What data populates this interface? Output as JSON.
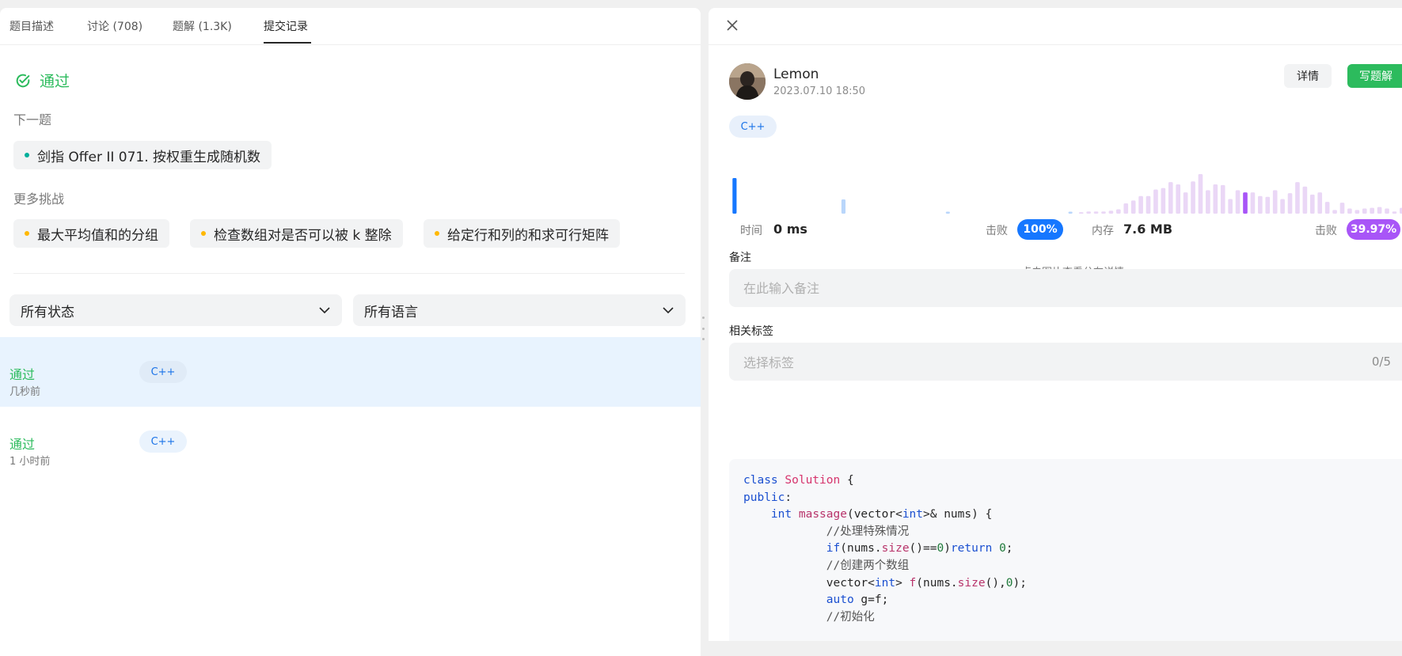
{
  "tabs": [
    {
      "label": "题目描述"
    },
    {
      "label": "讨论 (708)"
    },
    {
      "label": "题解 (1.3K)"
    },
    {
      "label": "提交记录"
    }
  ],
  "result": {
    "status": "通过"
  },
  "next": {
    "title": "下一题",
    "item": "剑指 Offer II 071. 按权重生成随机数"
  },
  "more": {
    "title": "更多挑战",
    "items": [
      "最大平均值和的分组",
      "检查数组对是否可以被 k 整除",
      "给定行和列的和求可行矩阵"
    ]
  },
  "filters": {
    "status": "所有状态",
    "language": "所有语言"
  },
  "submissions": [
    {
      "status": "通过",
      "time": "几秒前",
      "lang": "C++"
    },
    {
      "status": "通过",
      "time": "1 小时前",
      "lang": "C++"
    }
  ],
  "detail": {
    "user": "Lemon",
    "date": "2023.07.10 18:50",
    "detail_btn": "详情",
    "write_btn": "写题解",
    "lang": "C++",
    "runtime": {
      "label": "时间",
      "value": "0 ms",
      "beat_label": "击败",
      "beat": "100%"
    },
    "memory": {
      "label": "内存",
      "value": "7.6 MB",
      "beat_label": "击败",
      "beat": "39.97%"
    },
    "hint": "点击图片查看分布详情",
    "note_label": "备注",
    "note_placeholder": "在此输入备注",
    "tags_label": "相关标签",
    "tags_placeholder": "选择标签",
    "tags_count": "0/5"
  },
  "colors": {
    "accent": "#2cbb5d",
    "blue": "#1a73e8",
    "purple": "#a855f7",
    "memory_bar": "#ead7f6",
    "runtime_bar": "#1677ff"
  },
  "chart_data": [
    {
      "type": "bar",
      "title": "runtime distribution",
      "series": [
        {
          "name": "runtime",
          "values": [
            55,
            0,
            0,
            0,
            0,
            0,
            0,
            0,
            0,
            0,
            0,
            0,
            0,
            0,
            0,
            0,
            0,
            0,
            0,
            0,
            0,
            0,
            0,
            0,
            22,
            0,
            0,
            0,
            0,
            0,
            0,
            0,
            0,
            0,
            0,
            0,
            0,
            0,
            0,
            0,
            0,
            0,
            0,
            0,
            0,
            0,
            0,
            3,
            0,
            0,
            0,
            0,
            0,
            0,
            0,
            0,
            0,
            0,
            0,
            0,
            0,
            0,
            0,
            0,
            0,
            0,
            0,
            0,
            0,
            0,
            0,
            0,
            0,
            0,
            3
          ]
        }
      ],
      "highlight_index": 0
    },
    {
      "type": "bar",
      "title": "memory distribution",
      "series": [
        {
          "name": "memory",
          "values": [
            2,
            3,
            3,
            3,
            4,
            6,
            14,
            18,
            24,
            24,
            33,
            35,
            43,
            40,
            29,
            44,
            54,
            32,
            40,
            39,
            20,
            32,
            29,
            29,
            24,
            23,
            32,
            20,
            28,
            43,
            37,
            26,
            29,
            16,
            5,
            15,
            7,
            5,
            7,
            8,
            9,
            7,
            3,
            8,
            6
          ]
        }
      ],
      "highlight_index": 22
    }
  ]
}
